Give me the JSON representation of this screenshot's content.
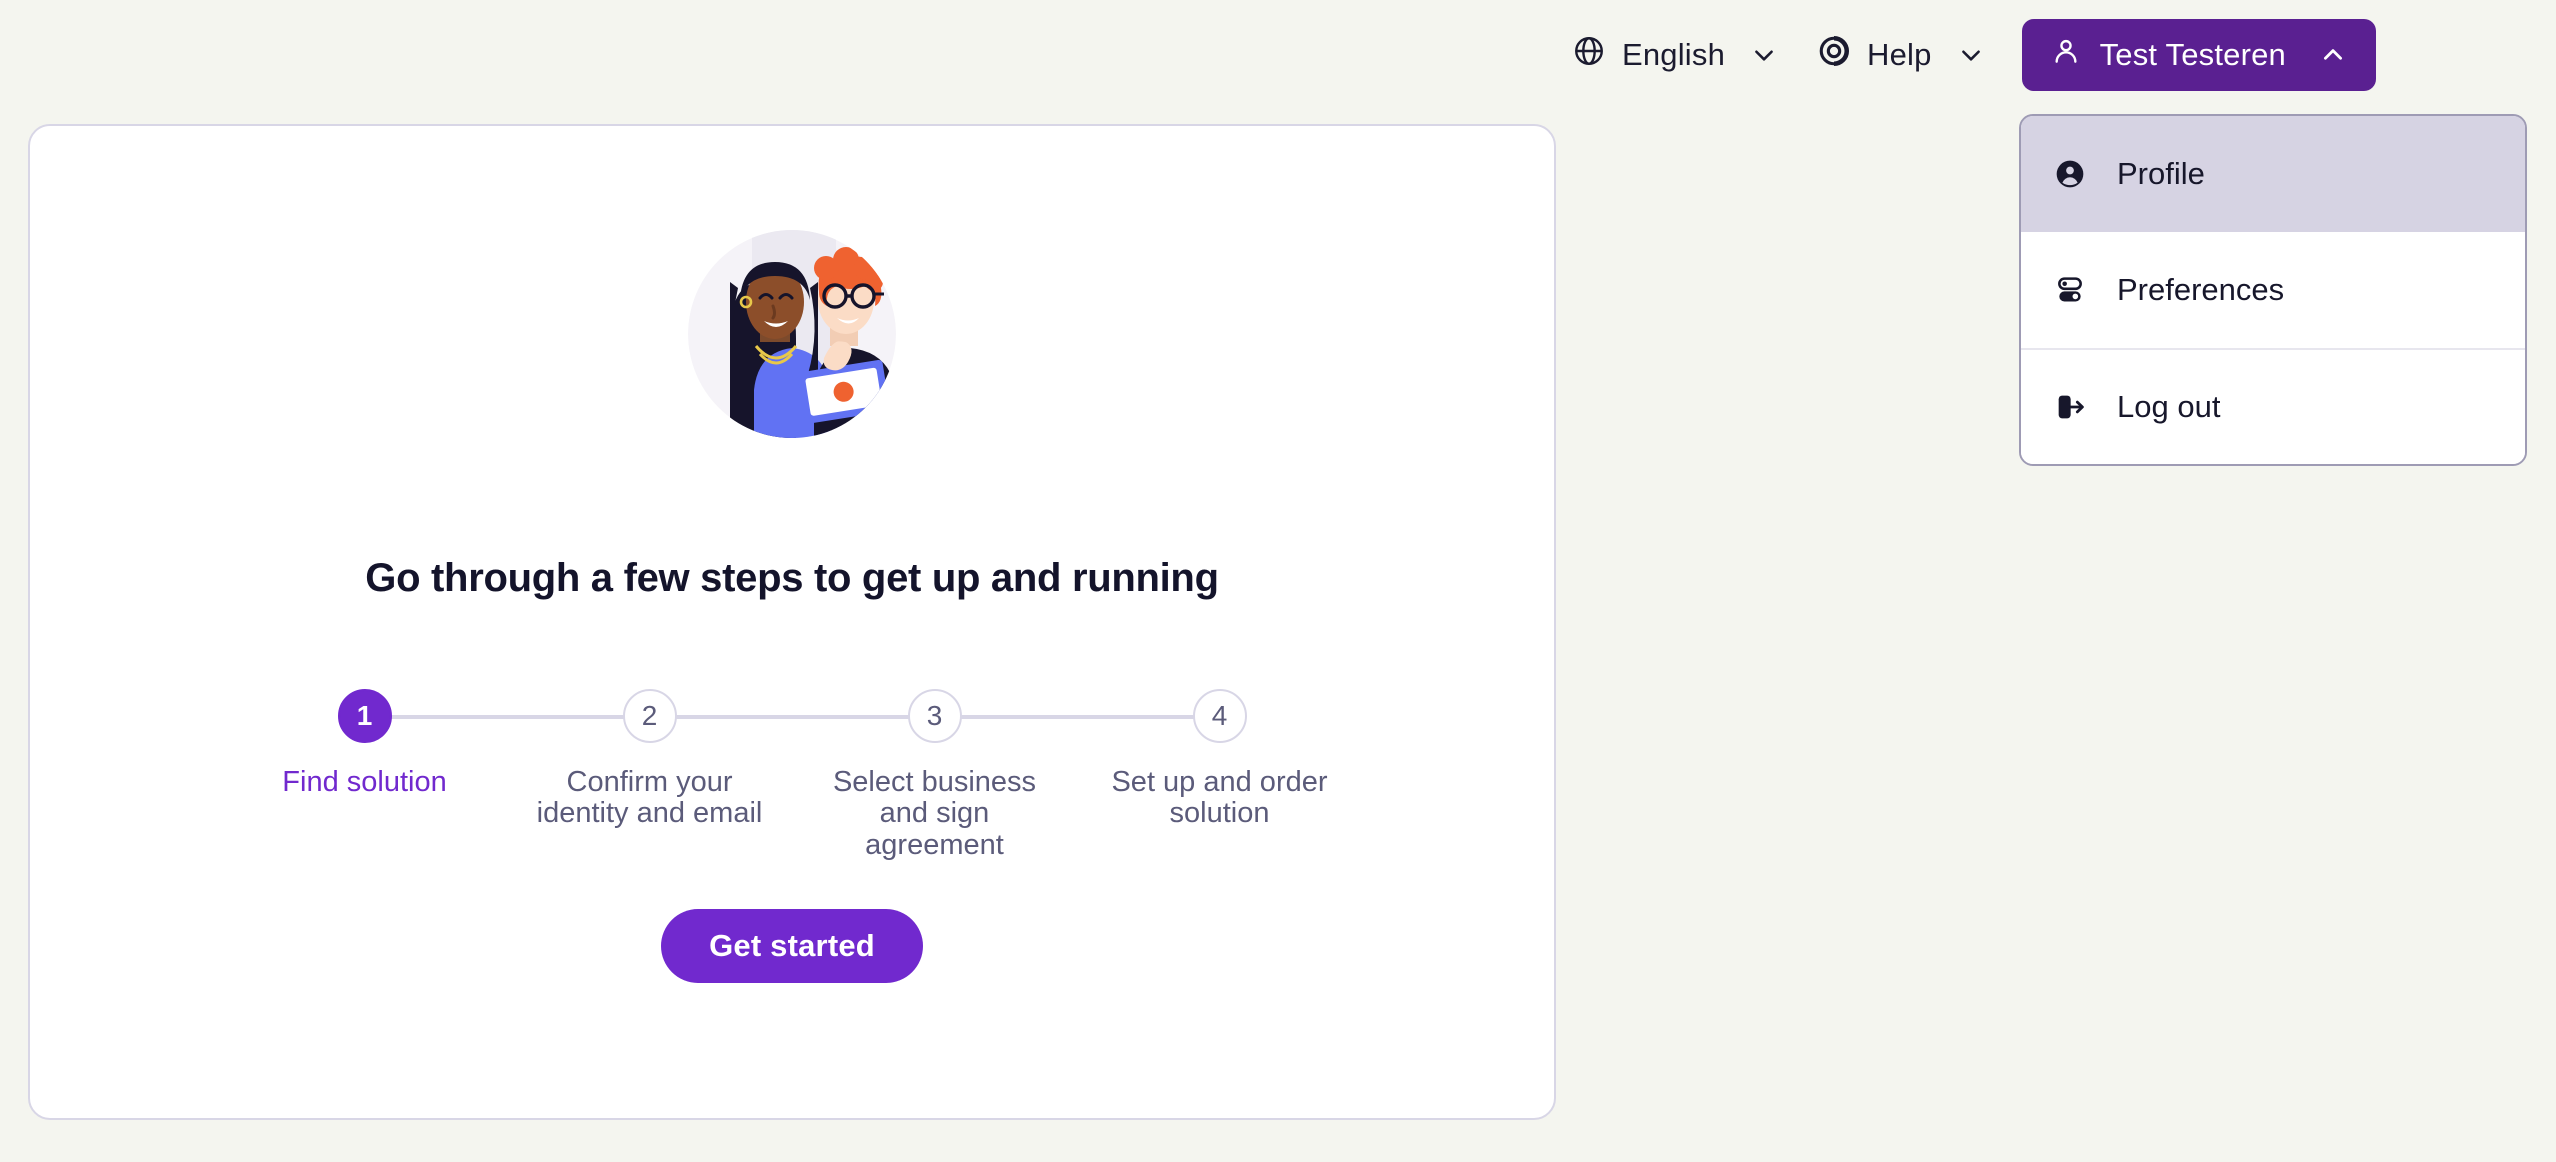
{
  "theme": {
    "page_bg": "#f4f5ef",
    "card_bg": "#ffffff",
    "card_border": "#d8d6e6",
    "accent_purple": "#7129ce",
    "header_purple": "#5a2091",
    "menu_highlight": "#d6d3e3",
    "menu_border": "#9e9bb4",
    "text_dark": "#14142b",
    "text_muted": "#5b5b7a"
  },
  "topbar": {
    "language": {
      "label": "English",
      "icon": "globe-icon",
      "chevron": "chevron-down-icon"
    },
    "help": {
      "label": "Help",
      "icon": "lifebuoy-icon",
      "chevron": "chevron-down-icon"
    },
    "user": {
      "label": "Test Testeren",
      "icon": "user-icon",
      "chevron": "chevron-up-icon",
      "expanded": true
    }
  },
  "user_menu": {
    "items": [
      {
        "label": "Profile",
        "icon": "user-circle-icon",
        "active": true
      },
      {
        "label": "Preferences",
        "icon": "toggles-icon",
        "active": false
      },
      {
        "label": "Log out",
        "icon": "logout-icon",
        "active": false
      }
    ]
  },
  "card": {
    "illustration": "two-people-illustration",
    "headline": "Go through a few steps to get up and running",
    "cta_label": "Get started",
    "stepper": {
      "steps": [
        {
          "number": "1",
          "label": "Find solution",
          "state": "active"
        },
        {
          "number": "2",
          "label": "Confirm your identity and email",
          "state": "pending"
        },
        {
          "number": "3",
          "label": "Select business and sign agreement",
          "state": "pending"
        },
        {
          "number": "4",
          "label": "Set up and order solution",
          "state": "pending"
        }
      ]
    }
  }
}
